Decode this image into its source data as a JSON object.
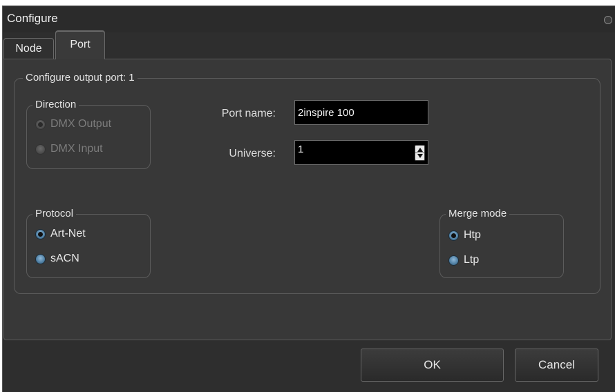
{
  "window": {
    "title": "Configure"
  },
  "tabs": [
    {
      "label": "Node",
      "active": false
    },
    {
      "label": "Port",
      "active": true
    }
  ],
  "port_config": {
    "group_title": "Configure output port: 1",
    "direction": {
      "title": "Direction",
      "options": [
        {
          "label": "DMX Output",
          "checked": true,
          "enabled": false
        },
        {
          "label": "DMX Input",
          "checked": false,
          "enabled": false
        }
      ]
    },
    "port_name": {
      "label": "Port name:",
      "value": "2inspire 100"
    },
    "universe": {
      "label": "Universe:",
      "value": "1"
    },
    "protocol": {
      "title": "Protocol",
      "options": [
        {
          "label": "Art-Net",
          "checked": true
        },
        {
          "label": "sACN",
          "checked": false
        }
      ]
    },
    "merge_mode": {
      "title": "Merge mode",
      "options": [
        {
          "label": "Htp",
          "checked": true
        },
        {
          "label": "Ltp",
          "checked": false
        }
      ]
    }
  },
  "buttons": {
    "ok": "OK",
    "cancel": "Cancel"
  },
  "colors": {
    "background": "#2e2e2e",
    "panel": "#383838",
    "field": "#000000",
    "radio_accent": "#4f7fa3"
  }
}
